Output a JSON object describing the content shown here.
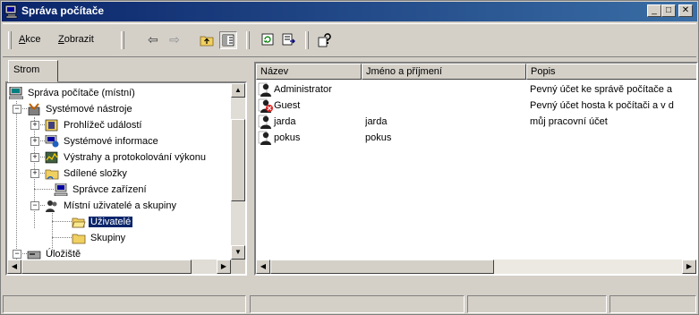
{
  "window": {
    "title": "Správa počítače",
    "min_label": "_",
    "max_label": "□",
    "close_label": "✕"
  },
  "menu": {
    "action_label": "Akce",
    "action_key": "A",
    "action_rest": "kce",
    "view_label": "Zobrazit",
    "view_key": "Z",
    "view_rest": "obrazit"
  },
  "toolbar": {
    "back": "⇦",
    "forward": "⇨"
  },
  "tabs": {
    "tree_label": "Strom"
  },
  "tree": {
    "items": [
      {
        "label": "Správa počítače (místní)",
        "icon": "computer-icon"
      },
      {
        "label": "Systémové nástroje",
        "icon": "tools-icon"
      },
      {
        "label": "Prohlížeč událostí",
        "icon": "event-viewer-icon"
      },
      {
        "label": "Systémové informace",
        "icon": "system-info-icon"
      },
      {
        "label": "Výstrahy a protokolování výkonu",
        "icon": "alerts-icon"
      },
      {
        "label": "Sdílené složky",
        "icon": "shared-folder-icon"
      },
      {
        "label": "Správce zařízení",
        "icon": "device-manager-icon"
      },
      {
        "label": "Místní uživatelé a skupiny",
        "icon": "users-groups-icon"
      },
      {
        "label": "Uživatelé",
        "icon": "folder-open-icon",
        "selected": true
      },
      {
        "label": "Skupiny",
        "icon": "folder-icon"
      },
      {
        "label": "Úložiště",
        "icon": "storage-icon"
      }
    ],
    "expander_minus": "−",
    "expander_plus": "+"
  },
  "list": {
    "columns": [
      "Název",
      "Jméno a příjmení",
      "Popis"
    ],
    "rows": [
      {
        "name": "Administrator",
        "full_name": "",
        "description": "Pevný účet ke správě počítače a",
        "disabled": false
      },
      {
        "name": "Guest",
        "full_name": "",
        "description": "Pevný účet hosta k počítači a v d",
        "disabled": true
      },
      {
        "name": "jarda",
        "full_name": "jarda",
        "description": "můj pracovní účet",
        "disabled": false
      },
      {
        "name": "pokus",
        "full_name": "pokus",
        "description": "",
        "disabled": false
      }
    ]
  },
  "colors": {
    "title_start": "#0a246a",
    "title_end": "#3a6ea5",
    "face": "#d4d0c8",
    "selection": "#0a246a"
  }
}
